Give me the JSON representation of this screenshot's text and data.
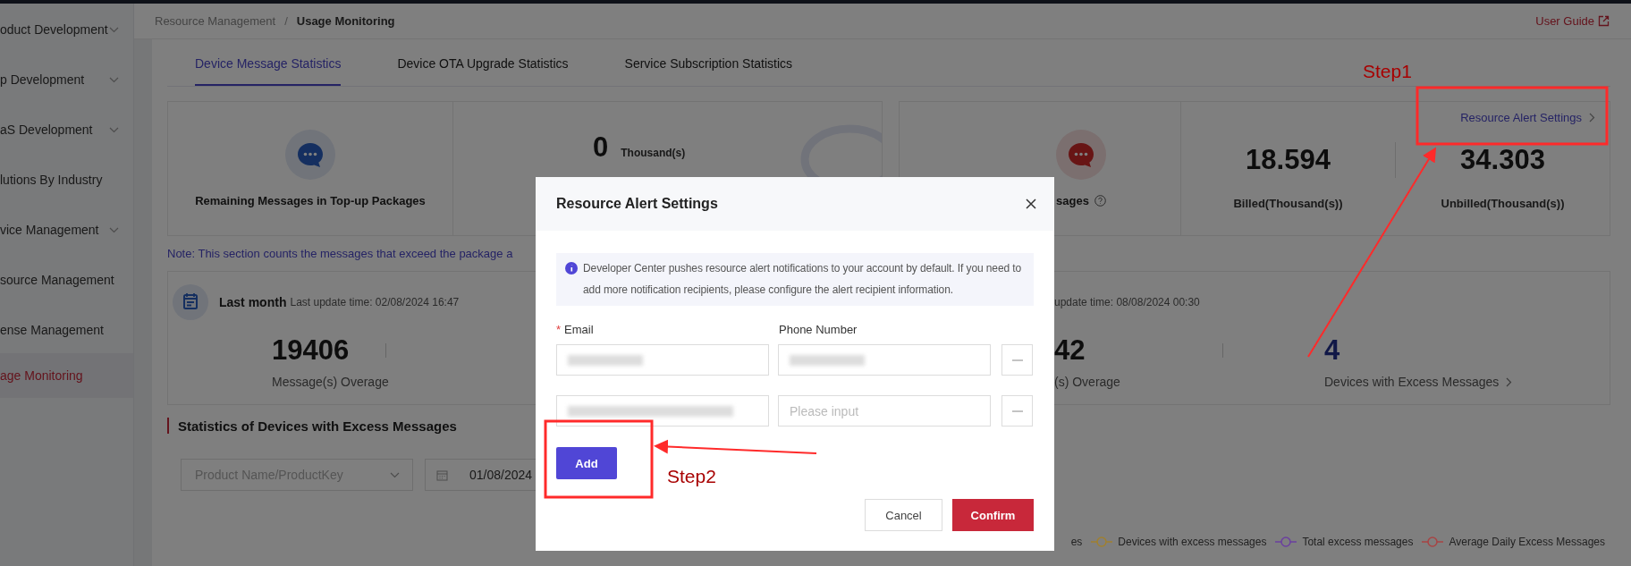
{
  "sidebar": {
    "items": [
      {
        "label": "oduct Development",
        "expandable": true,
        "selected": false
      },
      {
        "label": "p Development",
        "expandable": true,
        "selected": false
      },
      {
        "label": "aS Development",
        "expandable": true,
        "selected": false
      },
      {
        "label": "lutions By Industry",
        "expandable": false,
        "selected": false
      },
      {
        "label": "vice Management",
        "expandable": true,
        "selected": false
      },
      {
        "label": "source Management",
        "expandable": false,
        "selected": false
      },
      {
        "label": "ense Management",
        "expandable": false,
        "selected": false
      },
      {
        "label": "age Monitoring",
        "expandable": false,
        "selected": true
      }
    ]
  },
  "breadcrumb": {
    "items": [
      "Resource Management",
      "Usage Monitoring"
    ],
    "separator": "/"
  },
  "user_guide": "User Guide",
  "tabs": [
    {
      "label": "Device Message Statistics",
      "selected": true
    },
    {
      "label": "Device OTA Upgrade Statistics",
      "selected": false
    },
    {
      "label": "Service Subscription Statistics",
      "selected": false
    }
  ],
  "summary": {
    "package_label": "Remaining Messages in Top-up Packages",
    "package_value": "0",
    "package_unit": "Thousand(s)",
    "overage_label": "sages",
    "billed_value": "18.594",
    "billed_label": "Billed(Thousand(s))",
    "unbilled_value": "34.303",
    "unbilled_label": "Unbilled(Thousand(s))",
    "alert_link": "Resource Alert Settings"
  },
  "note": "Note: This section counts the messages that exceed the package a",
  "periods": {
    "last": {
      "title": "Last month",
      "update": "Last update time: 02/08/2024 16:47",
      "value": "19406",
      "label": "Message(s) Overage"
    },
    "current": {
      "update": "update time: 08/08/2024 00:30",
      "value": "42",
      "label": "(s) Overage",
      "devices_value": "4",
      "devices_label": "Devices with Excess Messages"
    }
  },
  "section_title": "Statistics of Devices with Excess Messages",
  "filters": {
    "product_placeholder": "Product Name/ProductKey",
    "date": "01/08/2024"
  },
  "legend": [
    {
      "label": "es"
    },
    {
      "label": "Devices with excess messages",
      "color": "#a08030"
    },
    {
      "label": "Total excess messages",
      "color": "#6b3fa0"
    },
    {
      "label": "Average Daily Excess Messages",
      "color": "#a84444"
    }
  ],
  "dialog": {
    "title": "Resource Alert Settings",
    "info": "Developer Center pushes resource alert notifications to your account by default. If you need to add more notification recipients, please configure the alert recipient information.",
    "email_label": "Email",
    "email_required_mark": "*",
    "phone_label": "Phone Number",
    "rows": [
      {
        "email_redacted": true,
        "phone_redacted": true
      },
      {
        "email_redacted": true,
        "phone_redacted": false,
        "phone_placeholder": "Please input"
      }
    ],
    "add": "Add",
    "cancel": "Cancel",
    "confirm": "Confirm"
  },
  "annotations": [
    {
      "label": "Step1"
    },
    {
      "label": "Step2"
    }
  ]
}
